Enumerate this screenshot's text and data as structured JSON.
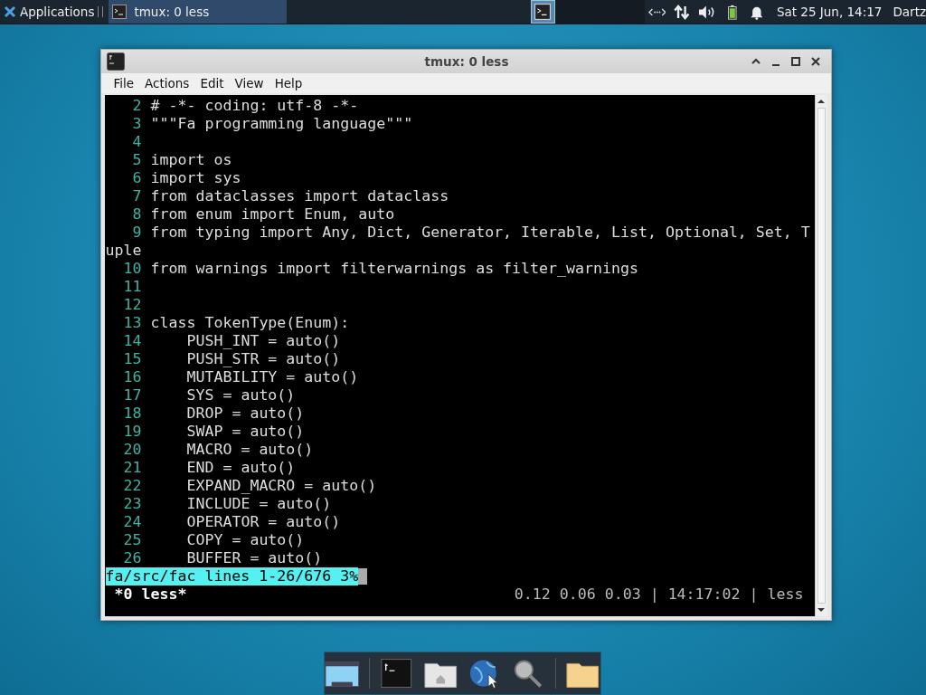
{
  "panel": {
    "apps_label": "Applications",
    "tasks": [
      {
        "title": "tmux: 0 less",
        "selected": true
      }
    ],
    "clock": "Sat 25 Jun, 14:17",
    "user": "Dartz"
  },
  "window": {
    "title": "tmux: 0 less",
    "menu": [
      "File",
      "Actions",
      "Edit",
      "View",
      "Help"
    ]
  },
  "terminal": {
    "lines": [
      {
        "number": "2",
        "text": "# -*- coding: utf-8 -*-"
      },
      {
        "number": "3",
        "text": "\"\"\"Fa programming language\"\"\""
      },
      {
        "number": "4"
      },
      {
        "number": "5",
        "text": "import os"
      },
      {
        "number": "6",
        "text": "import sys"
      },
      {
        "number": "7",
        "text": "from dataclasses import dataclass"
      },
      {
        "number": "8",
        "text": "from enum import Enum, auto"
      },
      {
        "number": "9",
        "text": "from typing import Any, Dict, Generator, Iterable, List, Optional, Set, T",
        "wrap": "uple"
      },
      {
        "number": "10",
        "text": "from warnings import filterwarnings as filter_warnings"
      },
      {
        "number": "11"
      },
      {
        "number": "12"
      },
      {
        "number": "13",
        "text": "class TokenType(Enum):"
      },
      {
        "number": "14",
        "text": "    PUSH_INT = auto()"
      },
      {
        "number": "15",
        "text": "    PUSH_STR = auto()"
      },
      {
        "number": "16",
        "text": "    MUTABILITY = auto()"
      },
      {
        "number": "17",
        "text": "    SYS = auto()"
      },
      {
        "number": "18",
        "text": "    DROP = auto()"
      },
      {
        "number": "19",
        "text": "    SWAP = auto()"
      },
      {
        "number": "20",
        "text": "    MACRO = auto()"
      },
      {
        "number": "21",
        "text": "    END = auto()"
      },
      {
        "number": "22",
        "text": "    EXPAND_MACRO = auto()"
      },
      {
        "number": "23",
        "text": "    INCLUDE = auto()"
      },
      {
        "number": "24",
        "text": "    OPERATOR = auto()"
      },
      {
        "number": "25",
        "text": "    COPY = auto()"
      },
      {
        "number": "26",
        "text": "    BUFFER = auto()"
      }
    ],
    "less_status": "fa/src/fac lines 1-26/676 3%",
    "tmux": {
      "window": "*0 less*",
      "status": "0.12 0.06 0.03 | 14:17:02 | less"
    }
  },
  "dock": [
    {
      "kind": "desktop"
    },
    {
      "kind": "terminal"
    },
    {
      "kind": "home"
    },
    {
      "kind": "web"
    },
    {
      "kind": "search"
    },
    {
      "kind": "folder"
    }
  ]
}
